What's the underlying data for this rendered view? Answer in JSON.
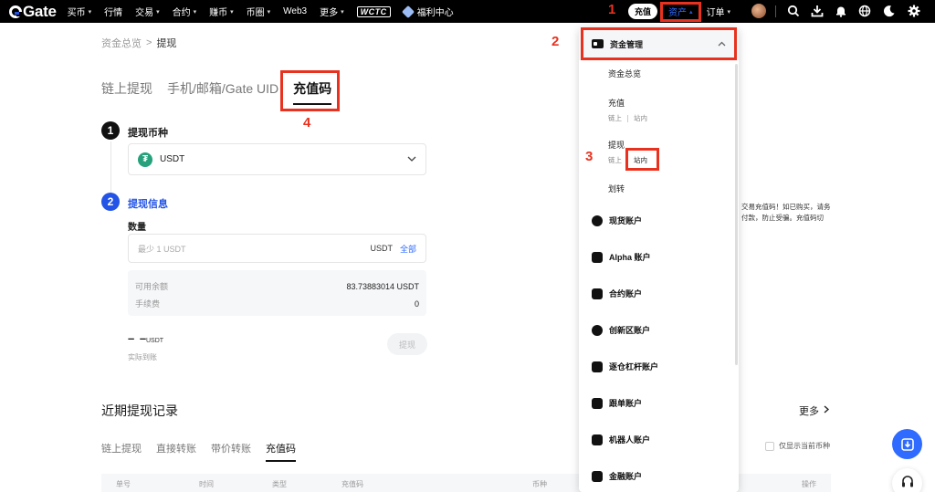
{
  "nav": {
    "logo": "Gate",
    "items": [
      {
        "label": "买币",
        "caret": true
      },
      {
        "label": "行情",
        "caret": false
      },
      {
        "label": "交易",
        "caret": true
      },
      {
        "label": "合约",
        "caret": true
      },
      {
        "label": "赚币",
        "caret": true
      },
      {
        "label": "币圈",
        "caret": true
      },
      {
        "label": "Web3",
        "caret": false
      },
      {
        "label": "更多",
        "caret": true
      }
    ],
    "wctc": "WCTC",
    "welfare": "福利中心",
    "deposit": "充值",
    "assets": "资产",
    "orders": "订单"
  },
  "breadcrumb": {
    "parent": "资金总览",
    "separator": ">",
    "current": "提现"
  },
  "withdraw_tabs": [
    "链上提现",
    "手机/邮箱/Gate UID",
    "充值码"
  ],
  "form": {
    "step1_num": "1",
    "step1_title": "提现币种",
    "coin_symbol": "₮",
    "coin": "USDT",
    "step2_num": "2",
    "step2_title": "提现信息",
    "amount_label": "数量",
    "amount_placeholder": "最少 1 USDT",
    "amount_unit": "USDT",
    "amount_all": "全部",
    "available_label": "可用余额",
    "available_value": "83.73883014 USDT",
    "fee_label": "手续费",
    "fee_value": "0",
    "arrival_value": "– –",
    "arrival_unit": "USDT",
    "arrival_label": "实际到账",
    "submit": "提现"
  },
  "recent": {
    "title": "近期提现记录",
    "more": "更多",
    "tabs": [
      "链上提现",
      "直接转账",
      "带价转账",
      "充值码"
    ],
    "only_current": "仅显示当前币种",
    "columns": [
      "单号",
      "时间",
      "类型",
      "充值码",
      "币种",
      "操作"
    ]
  },
  "dropdown": {
    "header": "资金管理",
    "overview": "资金总览",
    "deposit": "充值",
    "deposit_onchain": "链上",
    "deposit_internal": "站内",
    "withdraw": "提现",
    "withdraw_onchain": "链上",
    "withdraw_internal": "站内",
    "transfer": "划转",
    "accounts": [
      "现货账户",
      "Alpha 账户",
      "合约账户",
      "创新区账户",
      "逐仓杠杆账户",
      "跟单账户",
      "机器人账户",
      "金融账户"
    ]
  },
  "side_text_1": "交易充值码！如已购买，请务",
  "side_text_2": "付款，防止受骗。充值码切",
  "annotations": [
    "1",
    "2",
    "3",
    "4"
  ],
  "colors": {
    "accent": "#2f6bff",
    "annotation": "#e8321f",
    "tether": "#26a17b"
  }
}
